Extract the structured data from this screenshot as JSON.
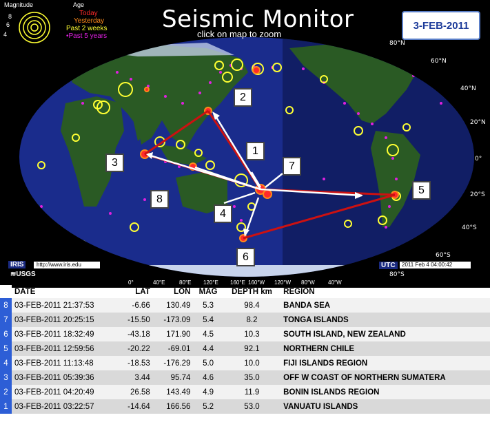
{
  "header": {
    "title": "Seismic Monitor",
    "subtitle": "click on map to zoom",
    "date": "3-FEB-2011"
  },
  "legend": {
    "magnitude_label": "Magnitude",
    "age_label": "Age",
    "mag_levels": [
      "8",
      "6",
      "4"
    ],
    "ages": [
      {
        "label": "Today",
        "color": "#ff2a2a"
      },
      {
        "label": "Yesterday",
        "color": "#ff8a1a"
      },
      {
        "label": "Past 2 weeks",
        "color": "#ffff33"
      },
      {
        "label": "Past 5 years",
        "color": "#e020e0",
        "prefix": "•"
      }
    ]
  },
  "map": {
    "lat_labels": [
      "80°N",
      "60°N",
      "40°N",
      "20°N",
      "0°",
      "20°S",
      "40°S",
      "60°S",
      "80°S"
    ],
    "lon_labels": [
      "0°",
      "40°E",
      "80°E",
      "120°E",
      "160°E",
      "160°W",
      "120°W",
      "80°W",
      "40°W"
    ],
    "iris": "IRIS",
    "iris_url": "http://www.iris.edu",
    "usgs": "USGS",
    "utc": "UTC",
    "utc_time": "2011 Feb  4 04:00:42",
    "callouts": [
      "1",
      "2",
      "3",
      "4",
      "5",
      "6",
      "7",
      "8"
    ],
    "colors": {
      "ocean": "#1a2c8c",
      "land": "#2a5a24",
      "ice": "#c8d4ec",
      "night": "#0b1446",
      "arrow_red": "#cc1111",
      "arrow_white": "#ffffff"
    }
  },
  "table": {
    "headers": [
      "DATE",
      "LAT",
      "LON",
      "MAG",
      "DEPTH km",
      "REGION"
    ],
    "rows": [
      {
        "rank": "8",
        "date": "03-FEB-2011 21:37:53",
        "lat": "-6.66",
        "lon": "130.49",
        "mag": "5.3",
        "depth": "98.4",
        "region": "BANDA SEA"
      },
      {
        "rank": "7",
        "date": "03-FEB-2011 20:25:15",
        "lat": "-15.50",
        "lon": "-173.09",
        "mag": "5.4",
        "depth": "8.2",
        "region": "TONGA ISLANDS"
      },
      {
        "rank": "6",
        "date": "03-FEB-2011 18:32:49",
        "lat": "-43.18",
        "lon": "171.90",
        "mag": "4.5",
        "depth": "10.3",
        "region": "SOUTH ISLAND, NEW ZEALAND"
      },
      {
        "rank": "5",
        "date": "03-FEB-2011 12:59:56",
        "lat": "-20.22",
        "lon": "-69.01",
        "mag": "4.4",
        "depth": "92.1",
        "region": "NORTHERN CHILE"
      },
      {
        "rank": "4",
        "date": "03-FEB-2011 11:13:48",
        "lat": "-18.53",
        "lon": "-176.29",
        "mag": "5.0",
        "depth": "10.0",
        "region": "FIJI ISLANDS REGION"
      },
      {
        "rank": "3",
        "date": "03-FEB-2011 05:39:36",
        "lat": "3.44",
        "lon": "95.74",
        "mag": "4.6",
        "depth": "35.0",
        "region": "OFF W COAST OF NORTHERN SUMATERA"
      },
      {
        "rank": "2",
        "date": "03-FEB-2011 04:20:49",
        "lat": "26.58",
        "lon": "143.49",
        "mag": "4.9",
        "depth": "11.9",
        "region": "BONIN ISLANDS REGION"
      },
      {
        "rank": "1",
        "date": "03-FEB-2011 03:22:57",
        "lat": "-14.64",
        "lon": "166.56",
        "mag": "5.2",
        "depth": "53.0",
        "region": "VANUATU ISLANDS"
      }
    ]
  }
}
